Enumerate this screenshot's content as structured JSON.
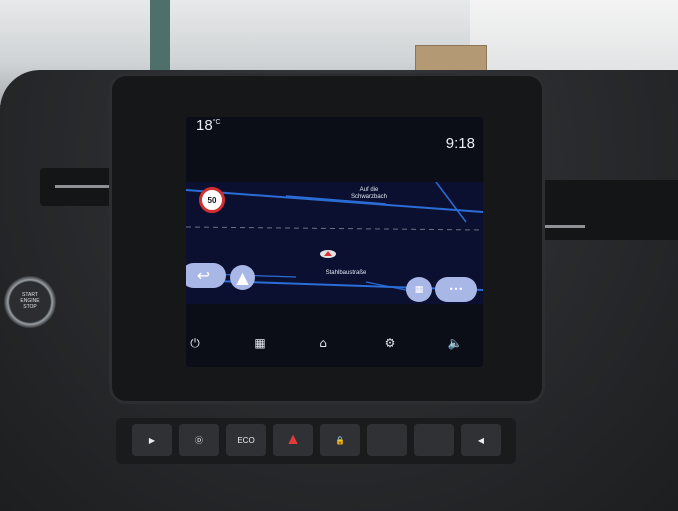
{
  "screen": {
    "temperature": "18",
    "temperature_unit": "°C",
    "clock": "9:18",
    "speed_limit": "50",
    "street_top_line1": "Auf die",
    "street_top_line2": "Schwarzbach",
    "current_street": "Stahlbaustraße"
  },
  "icons": {
    "back": "back-arrow-icon",
    "navigate": "navigation-arrow-icon",
    "route_options": "route-options-icon",
    "more": "more-icon",
    "power": "power-icon",
    "apps": "apps-grid-icon",
    "home": "home-icon",
    "car": "car-settings-icon",
    "volume": "volume-icon"
  },
  "buttons": {
    "more_glyph": "•••",
    "eco": "ECO",
    "start_line1": "START",
    "start_line2": "ENGINE",
    "start_line3": "STOP"
  },
  "colors": {
    "map_background": "#0c1030",
    "route_blue": "#2b6cd6",
    "pill_button": "#a8b7e6",
    "hazard_red": "#e23b3b"
  }
}
